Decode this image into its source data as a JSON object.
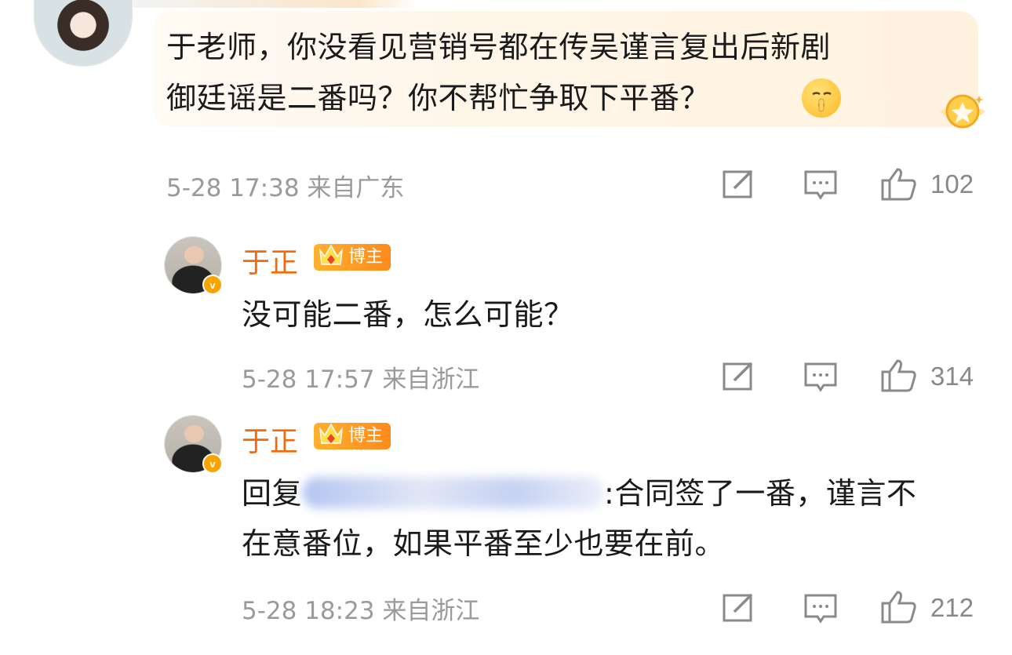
{
  "comment": {
    "text_line1": "于老师，你没看见营销号都在传吴谨言复出后新剧",
    "text_line2": "御廷谣是二番吗？你不帮忙争取下平番？",
    "time": "5-28 17:38 来自广东",
    "like_count": "102"
  },
  "replies": [
    {
      "username": "于正",
      "badge": "博主",
      "text": "没可能二番，怎么可能？",
      "time": "5-28 17:57 来自浙江",
      "like_count": "314"
    },
    {
      "username": "于正",
      "badge": "博主",
      "reply_prefix": "回复",
      "reply_suffix": ":合同签了一番，谨言不",
      "text_line2": "在意番位，如果平番至少也要在前。",
      "time": "5-28 18:23 来自浙江",
      "like_count": "212"
    }
  ],
  "icons": {
    "edit": "pencil-square-icon",
    "comment": "comment-bubble-icon",
    "like": "thumbs-up-icon"
  },
  "colors": {
    "username": "#f26a0a",
    "badge": "#ff8a1c",
    "meta": "#9a9a9a",
    "bubble": "#fff4e5"
  }
}
